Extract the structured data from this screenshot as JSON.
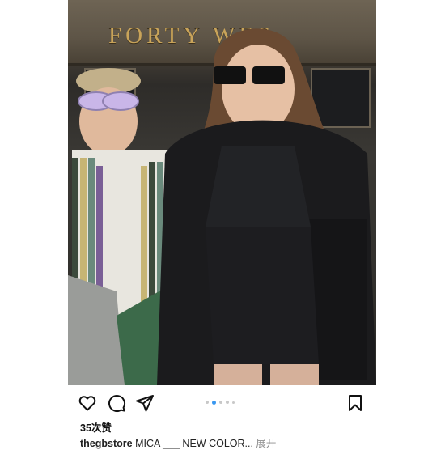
{
  "photo": {
    "sign_text": "FORTY   WES"
  },
  "actions": {
    "like_icon": "heart-icon",
    "comment_icon": "comment-icon",
    "share_icon": "paper-plane-icon",
    "save_icon": "bookmark-icon",
    "carousel_total": 5,
    "carousel_active": 2
  },
  "likes": {
    "text": "35次赞"
  },
  "caption": {
    "username": "thegbstore",
    "text": " MICA ___ NEW COLOR...",
    "more_label": " 展开"
  },
  "colors": {
    "accent": "#3897f0",
    "sign_gold": "#c9a45a"
  }
}
